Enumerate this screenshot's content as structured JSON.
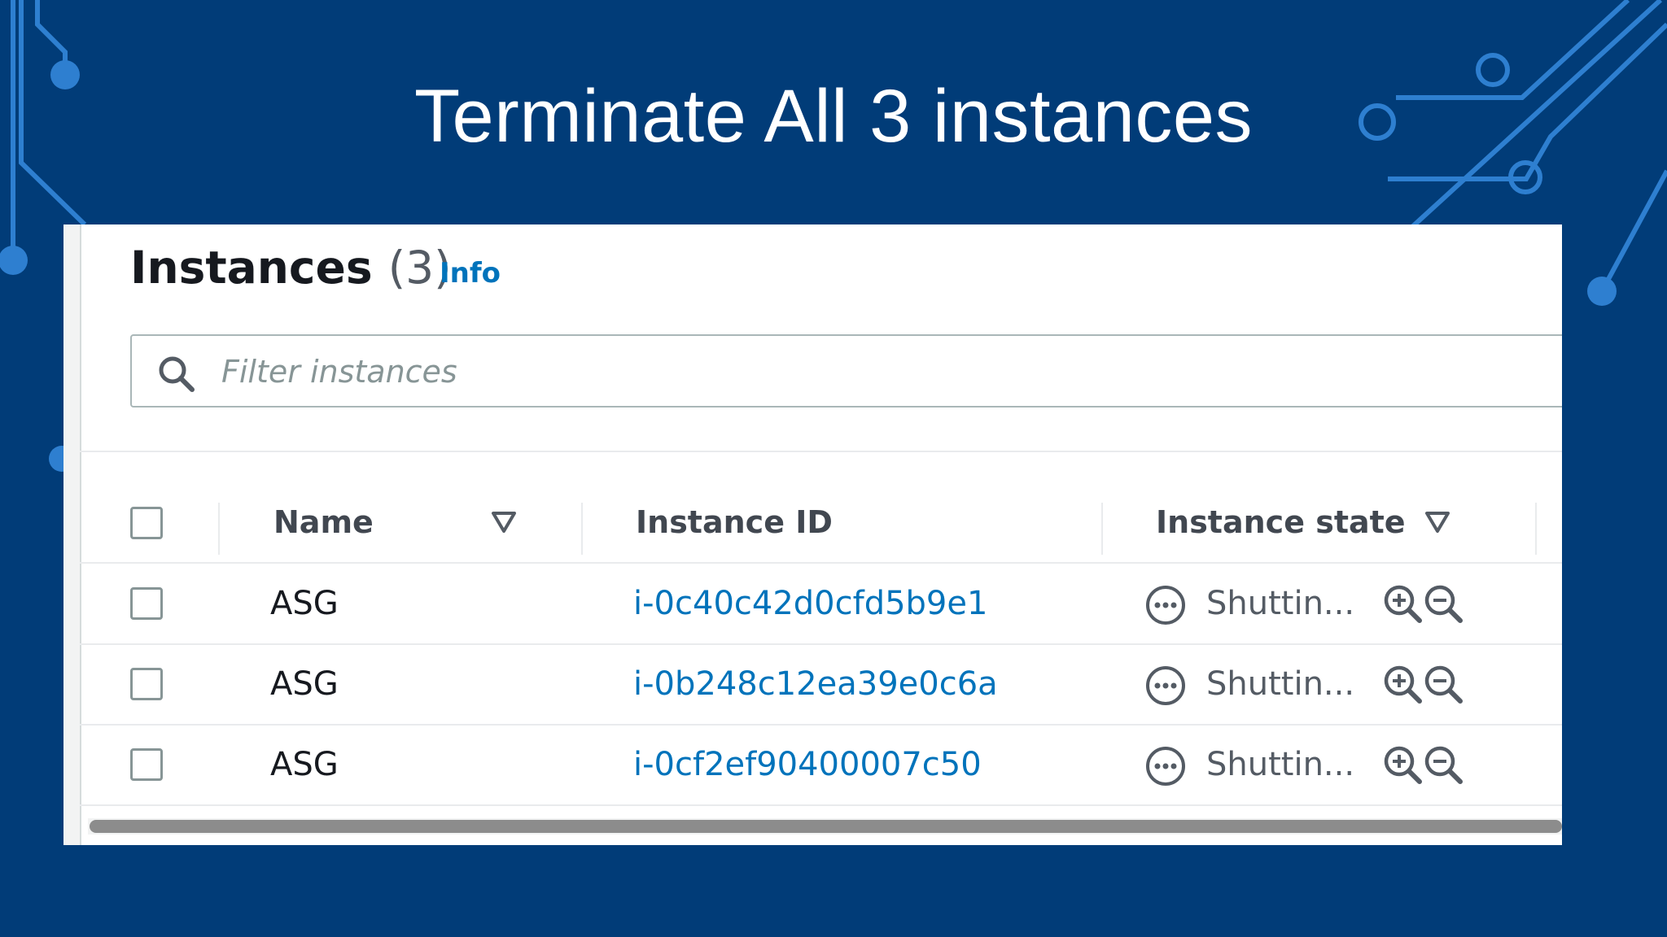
{
  "slide": {
    "title": "Terminate All 3 instances"
  },
  "panel": {
    "heading": "Instances",
    "count": "(3)",
    "info_link": "Info"
  },
  "search": {
    "placeholder": "Filter instances",
    "value": ""
  },
  "table": {
    "columns": [
      "Name",
      "Instance ID",
      "Instance state"
    ],
    "rows": [
      {
        "name": "ASG",
        "instance_id": "i-0c40c42d0cfd5b9e1",
        "state": "Shuttin..."
      },
      {
        "name": "ASG",
        "instance_id": "i-0b248c12ea39e0c6a",
        "state": "Shuttin..."
      },
      {
        "name": "ASG",
        "instance_id": "i-0cf2ef90400007c50",
        "state": "Shuttin..."
      }
    ]
  },
  "icons": {
    "search": "search-icon",
    "sort": "sort-caret-down-icon",
    "state": "pending-ellipsis-icon",
    "zoom_in": "zoom-in-icon",
    "zoom_out": "zoom-out-icon"
  },
  "colors": {
    "background": "#013c78",
    "circuit": "#2e7fd0",
    "link": "#0073bb",
    "title": "#ffffff"
  }
}
